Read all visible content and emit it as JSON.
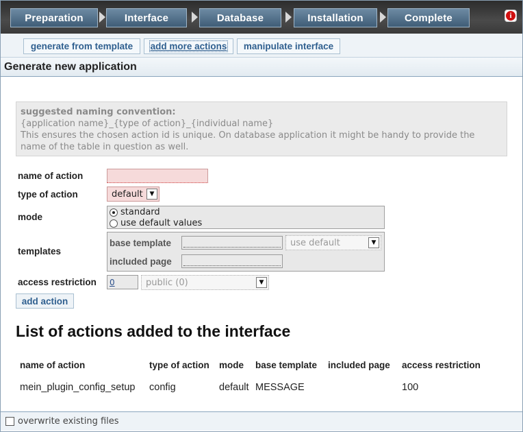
{
  "wizard": {
    "steps": [
      "Preparation",
      "Interface",
      "Database",
      "Installation",
      "Complete"
    ],
    "info_icon": "info-icon"
  },
  "subtabs": [
    {
      "label": "generate from template",
      "active": false
    },
    {
      "label": "add more actions",
      "active": true
    },
    {
      "label": "manipulate interface",
      "active": false
    }
  ],
  "section_title": "Generate new application",
  "naming": {
    "title": "suggested naming convention:",
    "pattern": "{application name}_{type of action}_{individual name}",
    "description": "This ensures the chosen action id is unique. On database application it might be handy to provide the name of the table in question as well."
  },
  "form": {
    "name_label": "name of action",
    "name_value": "",
    "type_label": "type of action",
    "type_value": "default",
    "mode_label": "mode",
    "mode_options": [
      "standard",
      "use default values"
    ],
    "mode_selected": "standard",
    "templates_label": "templates",
    "base_template_label": "base template",
    "base_template_value": "",
    "base_template_select": "use default",
    "included_page_label": "included page",
    "included_page_value": "",
    "access_label": "access restriction",
    "access_value": "0",
    "access_select": "public (0)",
    "add_button": "add action"
  },
  "list": {
    "title": "List of actions added to the interface",
    "columns": [
      "name of action",
      "type of action",
      "mode",
      "base template",
      "included page",
      "access restriction"
    ],
    "rows": [
      [
        "mein_plugin_config_setup",
        "config",
        "default",
        "MESSAGE",
        "",
        "100"
      ]
    ]
  },
  "footer": {
    "overwrite_label": "overwrite existing files",
    "overwrite_checked": false
  }
}
